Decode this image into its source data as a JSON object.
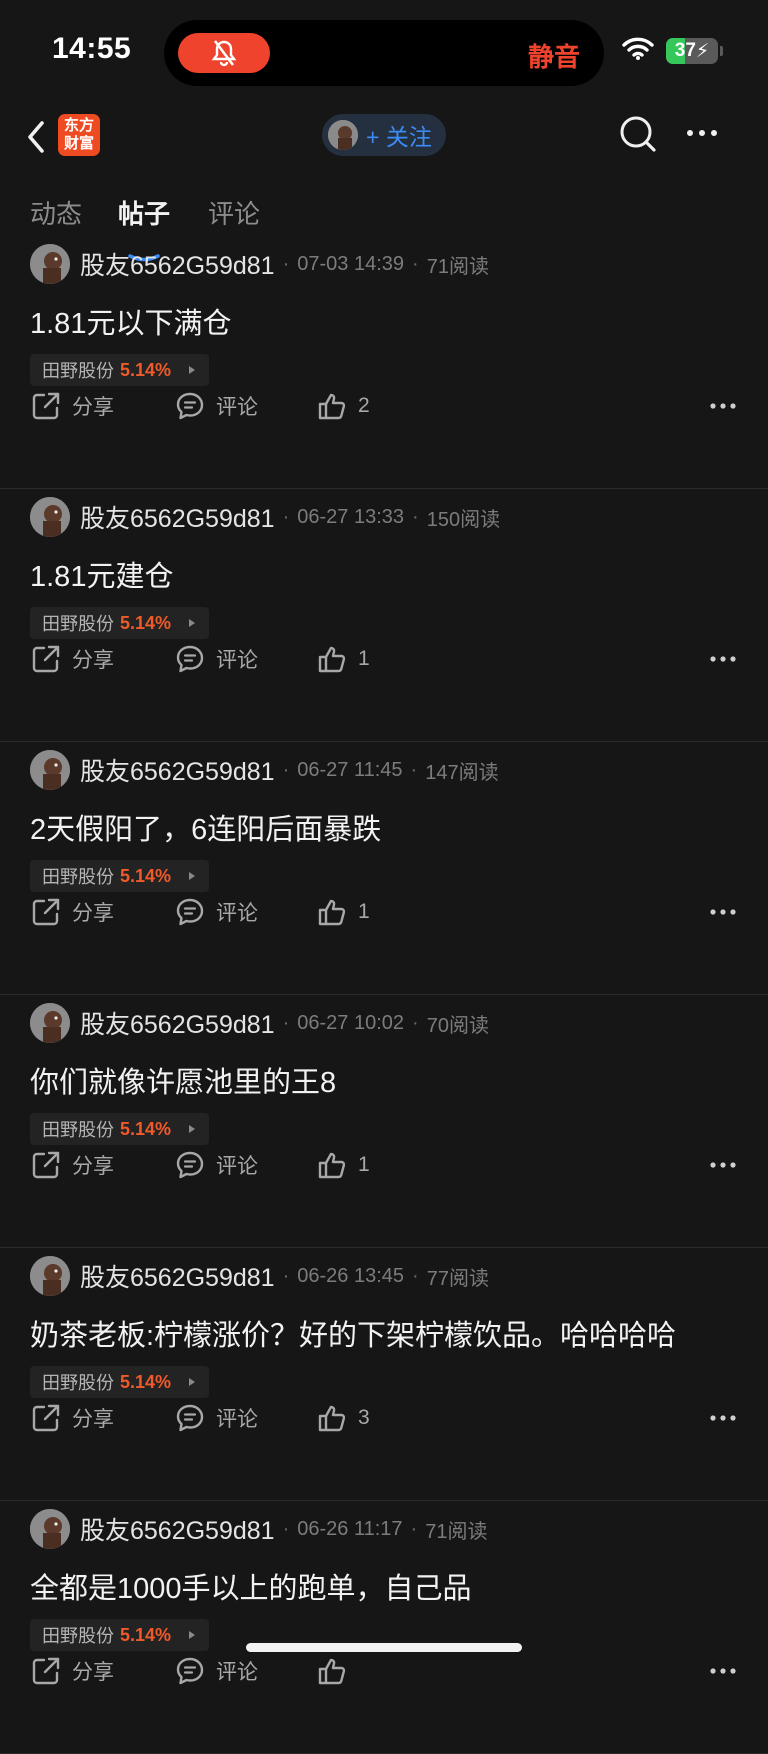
{
  "status": {
    "time": "14:55",
    "mute_label": "静音",
    "battery": "37",
    "battery_level": 0.37
  },
  "nav": {
    "logo_line1": "东方",
    "logo_line2": "财富",
    "follow_label": "+ 关注"
  },
  "tabs": [
    {
      "label": "动态"
    },
    {
      "label": "帖子"
    },
    {
      "label": "评论"
    }
  ],
  "action_labels": {
    "share": "分享",
    "comment": "评论"
  },
  "posts": [
    {
      "author": "股友6562G59d81",
      "date": "07-03 14:39",
      "reads": "71阅读",
      "text": "1.81元以下满仓",
      "stock": "田野股份",
      "pct": "5.14%",
      "likes": "2"
    },
    {
      "author": "股友6562G59d81",
      "date": "06-27 13:33",
      "reads": "150阅读",
      "text": "1.81元建仓",
      "stock": "田野股份",
      "pct": "5.14%",
      "likes": "1"
    },
    {
      "author": "股友6562G59d81",
      "date": "06-27 11:45",
      "reads": "147阅读",
      "text": "2天假阳了，6连阳后面暴跌",
      "stock": "田野股份",
      "pct": "5.14%",
      "likes": "1"
    },
    {
      "author": "股友6562G59d81",
      "date": "06-27 10:02",
      "reads": "70阅读",
      "text": "你们就像许愿池里的王8",
      "stock": "田野股份",
      "pct": "5.14%",
      "likes": "1"
    },
    {
      "author": "股友6562G59d81",
      "date": "06-26 13:45",
      "reads": "77阅读",
      "text": "奶茶老板:柠檬涨价？好的下架柠檬饮品。哈哈哈哈",
      "stock": "田野股份",
      "pct": "5.14%",
      "likes": "3"
    },
    {
      "author": "股友6562G59d81",
      "date": "06-26 11:17",
      "reads": "71阅读",
      "text": "全都是1000手以上的跑单，自己品",
      "stock": "田野股份",
      "pct": "5.14%",
      "likes": ""
    }
  ],
  "colors": {
    "accent_blue": "#3b8cf4",
    "up_red": "#f05a2a",
    "mute_red": "#f0432d"
  }
}
